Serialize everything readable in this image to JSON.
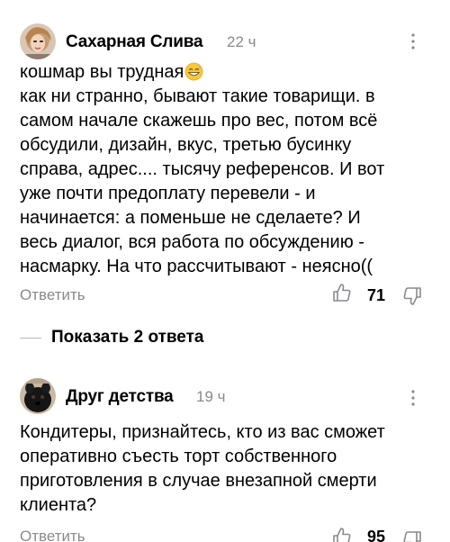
{
  "comments": [
    {
      "author": "Сахарная Слива",
      "time": "22 ч",
      "lines": [
        "кошмар вы трудная",
        "как ни странно, бывают такие товарищи. в",
        "самом начале скажешь про вес, потом всё",
        "обсудили, дизайн, вкус, третью бусинку",
        "справа, адрес.... тысячу референсов. И вот",
        "уже почти предоплату перевели - и",
        "начинается: а поменьше не сделаете? И",
        "весь диалог, вся работа по обсуждению -",
        "насмарку. На что рассчитывают - неясно(("
      ],
      "emoji": "grinning-sweat-emoji",
      "reply_label": "Ответить",
      "likes": "71",
      "show_replies_label": "Показать 2 ответа"
    },
    {
      "author": "Друг детства",
      "time": "19 ч",
      "lines": [
        "Кондитеры, признайтесь, кто из вас сможет",
        "оперативно съесть торт собственного",
        "приготовления в случае внезапной смерти",
        "клиента?"
      ],
      "reply_label": "Ответить",
      "likes": "95"
    }
  ],
  "colors": {
    "text": "#000000",
    "muted": "#8a8a8e",
    "divider": "#b9b9bd"
  }
}
